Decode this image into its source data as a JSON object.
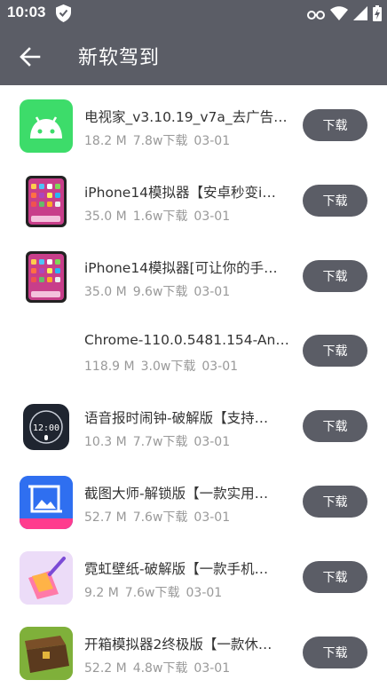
{
  "status_bar": {
    "time": "10:03",
    "icons": [
      "shield-icon",
      "vpn-key-icon",
      "wifi-icon",
      "signal-icon",
      "battery-icon"
    ]
  },
  "app_bar": {
    "back_icon": "arrow-left-icon",
    "title": "新软驾到"
  },
  "colors": {
    "header_bg": "#5b5d66",
    "button_bg": "#5b5d66",
    "title_text": "#333333",
    "meta_text": "#999999"
  },
  "apps": [
    {
      "name": "电视家_v3.10.19_v7a_去广告…",
      "size": "18.2 M",
      "downloads": "7.8w下载",
      "date": "03-01",
      "icon": "android-icon",
      "button": "下载"
    },
    {
      "name": "iPhone14模拟器【安卓秒变i…",
      "size": "35.0 M",
      "downloads": "1.6w下载",
      "date": "03-01",
      "icon": "phone-screenshot-icon",
      "button": "下载"
    },
    {
      "name": "iPhone14模拟器[可让你的手…",
      "size": "35.0 M",
      "downloads": "9.6w下载",
      "date": "03-01",
      "icon": "phone-screenshot-icon",
      "button": "下载"
    },
    {
      "name": "Chrome-110.0.5481.154-An…",
      "size": "118.9 M",
      "downloads": "3.0w下载",
      "date": "03-01",
      "icon": "blank-icon",
      "button": "下载"
    },
    {
      "name": "语音报时闹钟-破解版【支持…",
      "size": "10.3 M",
      "downloads": "7.7w下载",
      "date": "03-01",
      "icon": "clock-icon",
      "button": "下载"
    },
    {
      "name": "截图大师-解锁版【一款实用…",
      "size": "52.7 M",
      "downloads": "7.6w下载",
      "date": "03-01",
      "icon": "screenshot-tool-icon",
      "button": "下载"
    },
    {
      "name": "霓虹壁纸-破解版【一款手机…",
      "size": "9.2 M",
      "downloads": "7.6w下载",
      "date": "03-01",
      "icon": "paint-icon",
      "button": "下载"
    },
    {
      "name": "开箱模拟器2终极版【一款休…",
      "size": "52.2 M",
      "downloads": "4.8w下载",
      "date": "03-01",
      "icon": "chest-icon",
      "button": "下载"
    }
  ]
}
